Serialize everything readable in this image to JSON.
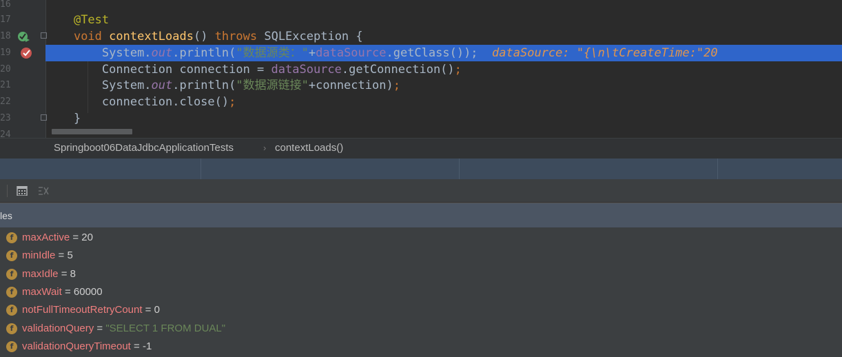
{
  "editor": {
    "line_numbers": [
      "16",
      "17",
      "18",
      "19",
      "20",
      "21",
      "22",
      "23",
      "24"
    ],
    "lines": [
      {
        "indent": "    ",
        "tokens": [
          {
            "t": "@Test",
            "c": "ann"
          }
        ]
      },
      {
        "indent": "    ",
        "tokens": [
          {
            "t": "void ",
            "c": "kw"
          },
          {
            "t": "contextLoads",
            "c": "fn"
          },
          {
            "t": "() ",
            "c": "plain"
          },
          {
            "t": "throws ",
            "c": "kw"
          },
          {
            "t": "SQLException {",
            "c": "plain"
          }
        ]
      },
      {
        "indent": "        ",
        "tokens": [
          {
            "t": "System.",
            "c": "plain"
          },
          {
            "t": "out",
            "c": "fld"
          },
          {
            "t": ".println(",
            "c": "plain"
          },
          {
            "t": "\"数据源类：\"",
            "c": "str"
          },
          {
            "t": "+",
            "c": "plain"
          },
          {
            "t": "dataSource",
            "c": "var"
          },
          {
            "t": ".getClass());",
            "c": "plain"
          }
        ],
        "inline_name": "dataSource: ",
        "inline_value": "\"{\\n\\tCreateTime:\"20"
      },
      {
        "indent": "        ",
        "tokens": [
          {
            "t": "Connection connection = ",
            "c": "plain"
          },
          {
            "t": "dataSource",
            "c": "var"
          },
          {
            "t": ".getConnection()",
            "c": "plain"
          },
          {
            "t": ";",
            "c": "kw"
          }
        ]
      },
      {
        "indent": "        ",
        "tokens": [
          {
            "t": "System.",
            "c": "plain"
          },
          {
            "t": "out",
            "c": "fld"
          },
          {
            "t": ".println(",
            "c": "plain"
          },
          {
            "t": "\"数据源链接\"",
            "c": "str"
          },
          {
            "t": "+connection)",
            "c": "plain"
          },
          {
            "t": ";",
            "c": "kw"
          }
        ]
      },
      {
        "indent": "        ",
        "tokens": [
          {
            "t": "connection.close()",
            "c": "plain"
          },
          {
            "t": ";",
            "c": "kw"
          }
        ]
      },
      {
        "indent": "    ",
        "tokens": [
          {
            "t": "}",
            "c": "plain"
          }
        ]
      }
    ]
  },
  "breadcrumb": {
    "class_name": "Springboot06DataJdbcApplicationTests",
    "separator": "›",
    "method_name": "contextLoads()"
  },
  "variables_panel": {
    "title": "les",
    "field_icon": "f",
    "rows": [
      {
        "name": "maxActive",
        "value": "20",
        "is_string": false
      },
      {
        "name": "minIdle",
        "value": "5",
        "is_string": false
      },
      {
        "name": "maxIdle",
        "value": "8",
        "is_string": false
      },
      {
        "name": "maxWait",
        "value": "60000",
        "is_string": false
      },
      {
        "name": "notFullTimeoutRetryCount",
        "value": "0",
        "is_string": false
      },
      {
        "name": "validationQuery",
        "value": "\"SELECT 1 FROM DUAL\"",
        "is_string": true
      },
      {
        "name": "validationQueryTimeout",
        "value": "-1",
        "is_string": false
      }
    ]
  },
  "icons": {
    "run_gutter": "run-test-icon",
    "breakpoint": "breakpoint-icon",
    "calculator": "evaluate-expression-icon",
    "trace": "trace-icon"
  },
  "colors": {
    "highlight": "#2f65ca",
    "keyword": "#cc7832",
    "function": "#ffc66d",
    "string": "#6a8759",
    "field": "#9876aa",
    "variable_name": "#ef7e7e"
  }
}
